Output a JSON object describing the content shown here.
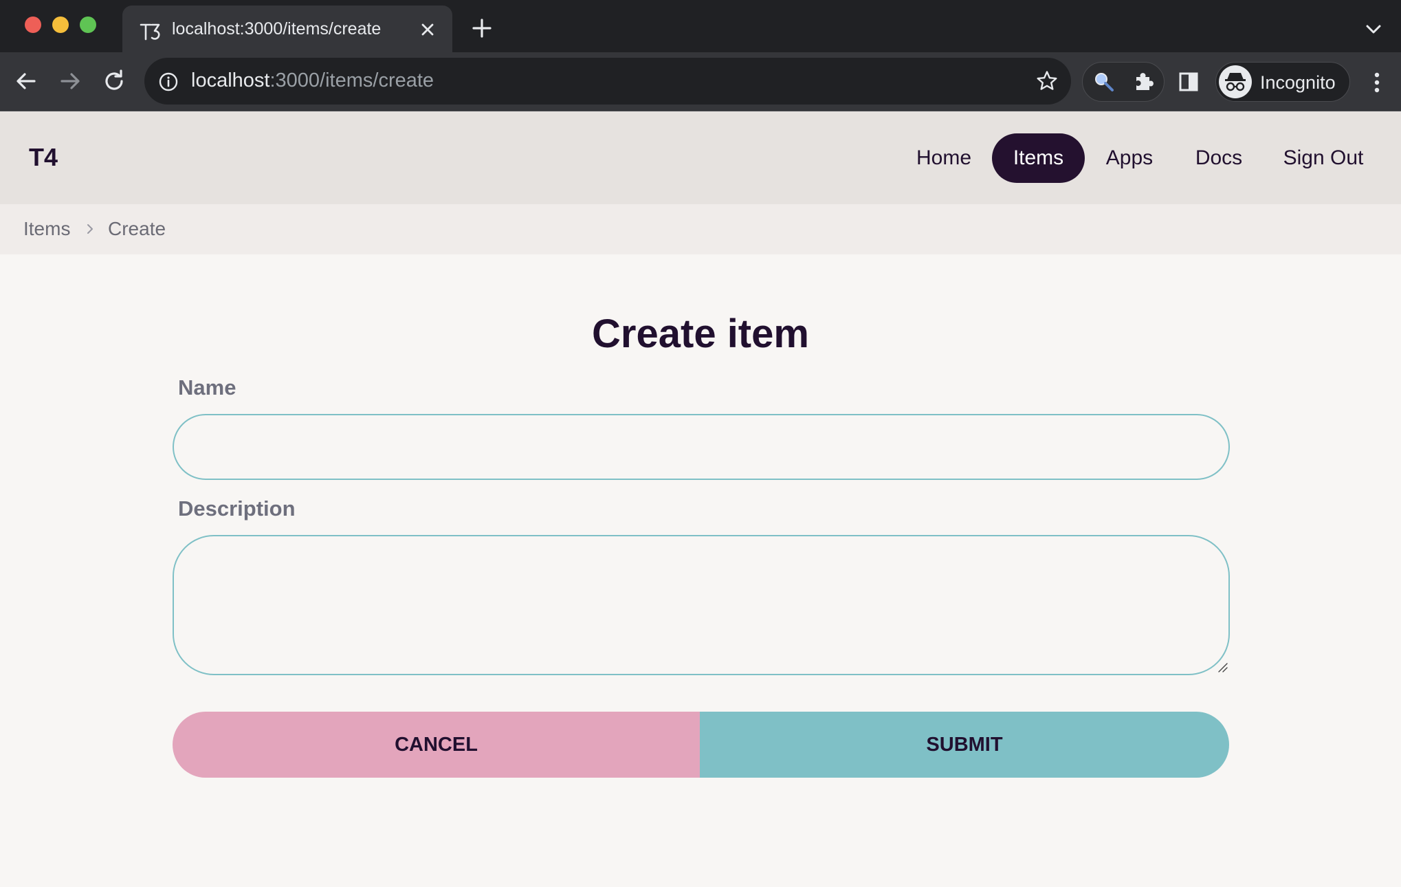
{
  "browser": {
    "tab_title": "localhost:3000/items/create",
    "url_host": "localhost",
    "url_rest": ":3000/items/create",
    "profile_label": "Incognito",
    "icons": [
      "back-icon",
      "forward-icon",
      "reload-icon",
      "info-icon",
      "star-icon",
      "magnifier-extension-icon",
      "puzzle-icon",
      "side-panel-icon",
      "incognito-icon",
      "more-menu-icon",
      "tab-search-icon",
      "new-tab-icon",
      "close-tab-icon"
    ]
  },
  "app": {
    "brand": "T4",
    "nav": {
      "home": "Home",
      "items": "Items",
      "apps": "Apps",
      "docs": "Docs",
      "sign_out": "Sign Out"
    },
    "active_nav": "Items"
  },
  "breadcrumb": {
    "items": "Items",
    "create": "Create"
  },
  "form": {
    "title": "Create item",
    "name_label": "Name",
    "name_value": "",
    "description_label": "Description",
    "description_value": "",
    "cancel_label": "CANCEL",
    "submit_label": "SUBMIT"
  },
  "colors": {
    "header_bg": "#e6e2df",
    "active_nav_bg": "#24112f",
    "brand_text": "#21102f",
    "input_border": "#7fc0c6",
    "cancel_bg": "#e3a5bc",
    "submit_bg": "#7fc0c6",
    "page_bg": "#f8f6f4"
  }
}
